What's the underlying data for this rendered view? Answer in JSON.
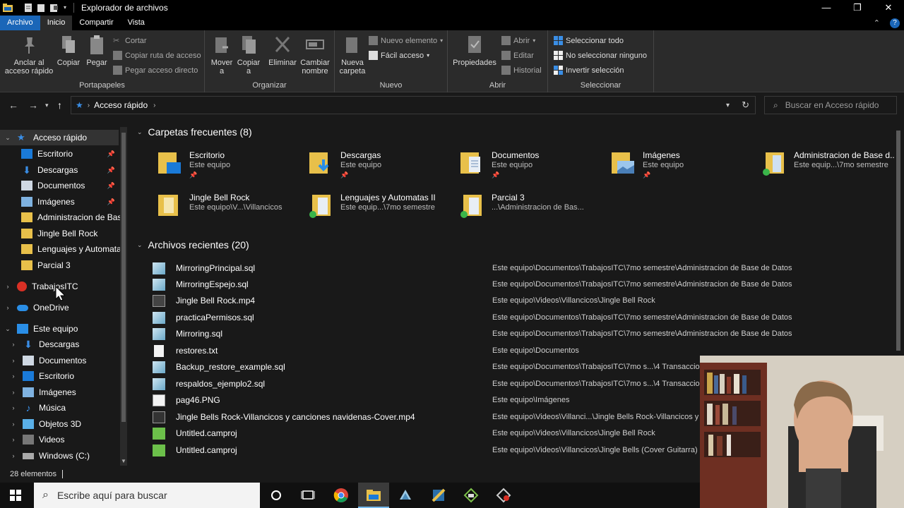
{
  "window": {
    "title": "Explorador de archivos"
  },
  "ribbon_tabs": [
    "Archivo",
    "Inicio",
    "Compartir",
    "Vista"
  ],
  "ribbon": {
    "portapapeles": {
      "label": "Portapapeles",
      "anclar": "Anclar al acceso rápido",
      "copiar": "Copiar",
      "pegar": "Pegar",
      "cortar": "Cortar",
      "copiar_ruta": "Copiar ruta de acceso",
      "pegar_acceso": "Pegar acceso directo"
    },
    "organizar": {
      "label": "Organizar",
      "mover": "Mover a",
      "copiar_a": "Copiar a",
      "eliminar": "Eliminar",
      "cambiar": "Cambiar nombre"
    },
    "nuevo": {
      "label": "Nuevo",
      "nueva_carpeta": "Nueva carpeta",
      "nuevo_elemento": "Nuevo elemento",
      "facil_acceso": "Fácil acceso"
    },
    "abrir": {
      "label": "Abrir",
      "propiedades": "Propiedades",
      "abrir": "Abrir",
      "editar": "Editar",
      "historial": "Historial"
    },
    "seleccionar": {
      "label": "Seleccionar",
      "todo": "Seleccionar todo",
      "ninguno": "No seleccionar ninguno",
      "invertir": "Invertir selección"
    }
  },
  "address": {
    "crumb": "Acceso rápido",
    "search_placeholder": "Buscar en Acceso rápido"
  },
  "nav": {
    "quick_access": "Acceso rápido",
    "quick_items": [
      "Escritorio",
      "Descargas",
      "Documentos",
      "Imágenes",
      "Administracion de Base",
      "Jingle Bell Rock",
      "Lenguajes y Automatas",
      "Parcial 3"
    ],
    "trabajos": "TrabajosITC",
    "onedrive": "OneDrive",
    "este_equipo": "Este equipo",
    "equipo_items": [
      "Descargas",
      "Documentos",
      "Escritorio",
      "Imágenes",
      "Música",
      "Objetos 3D",
      "Videos",
      "Windows (C:)"
    ]
  },
  "frequent": {
    "heading": "Carpetas frecuentes (8)",
    "items": [
      {
        "name": "Escritorio",
        "sub": "Este equipo"
      },
      {
        "name": "Descargas",
        "sub": "Este equipo"
      },
      {
        "name": "Documentos",
        "sub": "Este equipo"
      },
      {
        "name": "Imágenes",
        "sub": "Este equipo"
      },
      {
        "name": "Administracion de Base d...",
        "sub": "Este equip...\\7mo semestre"
      },
      {
        "name": "Jingle Bell Rock",
        "sub": "Este equipo\\V...\\Villancicos"
      },
      {
        "name": "Lenguajes y Automatas II",
        "sub": "Este equip...\\7mo semestre"
      },
      {
        "name": "Parcial 3",
        "sub": "...\\Administracion de Bas..."
      }
    ]
  },
  "recent": {
    "heading": "Archivos recientes (20)",
    "items": [
      {
        "name": "MirroringPrincipal.sql",
        "path": "Este equipo\\Documentos\\TrabajosITC\\7mo semestre\\Administracion de Base de Datos"
      },
      {
        "name": "MirroringEspejo.sql",
        "path": "Este equipo\\Documentos\\TrabajosITC\\7mo semestre\\Administracion de Base de Datos"
      },
      {
        "name": "Jingle Bell Rock.mp4",
        "path": "Este equipo\\Videos\\Villancicos\\Jingle Bell Rock"
      },
      {
        "name": "practicaPermisos.sql",
        "path": "Este equipo\\Documentos\\TrabajosITC\\7mo semestre\\Administracion de Base de Datos"
      },
      {
        "name": "Mirroring.sql",
        "path": "Este equipo\\Documentos\\TrabajosITC\\7mo semestre\\Administracion de Base de Datos"
      },
      {
        "name": "restores.txt",
        "path": "Este equipo\\Documentos"
      },
      {
        "name": "Backup_restore_example.sql",
        "path": "Este equipo\\Documentos\\TrabajosITC\\7mo s...\\4 Transaccio"
      },
      {
        "name": "respaldos_ejemplo2.sql",
        "path": "Este equipo\\Documentos\\TrabajosITC\\7mo s...\\4 Transaccio"
      },
      {
        "name": "pag46.PNG",
        "path": "Este equipo\\Imágenes"
      },
      {
        "name": "Jingle Bells Rock-Villancicos y canciones navidenas-Cover.mp4",
        "path": "Este equipo\\Videos\\Villanci...\\Jingle Bells Rock-Villancicos y"
      },
      {
        "name": "Untitled.camproj",
        "path": "Este equipo\\Videos\\Villancicos\\Jingle Bell Rock"
      },
      {
        "name": "Untitled.camproj",
        "path": "Este equipo\\Videos\\Villancicos\\Jingle Bells (Cover Guitarra)"
      }
    ]
  },
  "status": {
    "count": "28 elementos"
  },
  "taskbar": {
    "search_placeholder": "Escribe aquí para buscar"
  },
  "colors": {
    "accent": "#1a66b8",
    "folder": "#e8c04a",
    "background": "#191919"
  }
}
